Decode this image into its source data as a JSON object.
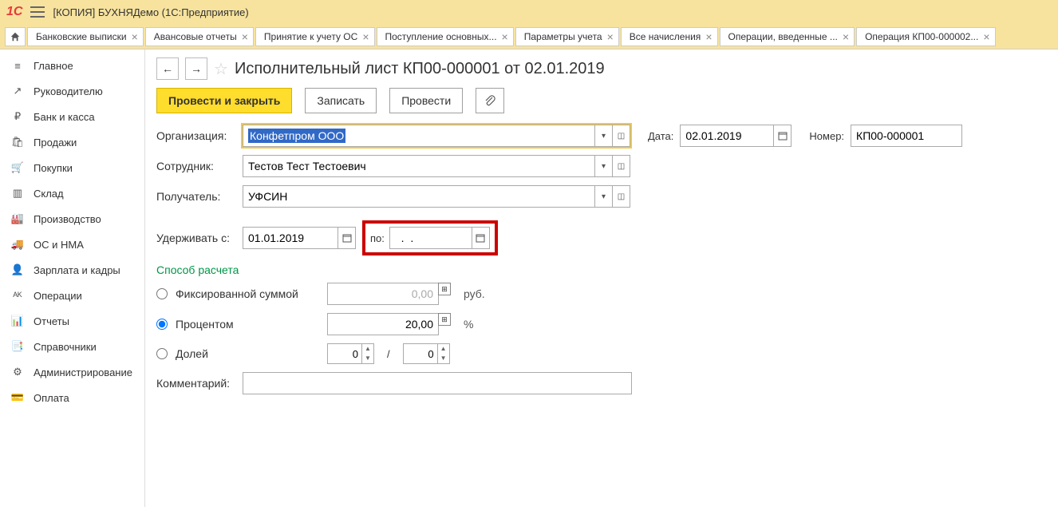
{
  "titlebar": {
    "text": "[КОПИЯ] БУХНЯДемо  (1С:Предприятие)"
  },
  "tabs": [
    {
      "label": "Банковские выписки"
    },
    {
      "label": "Авансовые отчеты"
    },
    {
      "label": "Принятие к учету ОС"
    },
    {
      "label": "Поступление основных..."
    },
    {
      "label": "Параметры учета"
    },
    {
      "label": "Все начисления"
    },
    {
      "label": "Операции, введенные ..."
    },
    {
      "label": "Операция КП00-000002..."
    }
  ],
  "sidebar": {
    "items": [
      {
        "label": "Главное",
        "icon": "≡"
      },
      {
        "label": "Руководителю",
        "icon": "↗"
      },
      {
        "label": "Банк и касса",
        "icon": "₽"
      },
      {
        "label": "Продажи",
        "icon": "🛍"
      },
      {
        "label": "Покупки",
        "icon": "🛒"
      },
      {
        "label": "Склад",
        "icon": "▥"
      },
      {
        "label": "Производство",
        "icon": "🏭"
      },
      {
        "label": "ОС и НМА",
        "icon": "🚚"
      },
      {
        "label": "Зарплата и кадры",
        "icon": "👤"
      },
      {
        "label": "Операции",
        "icon": "ᴬᴷ"
      },
      {
        "label": "Отчеты",
        "icon": "📊"
      },
      {
        "label": "Справочники",
        "icon": "📑"
      },
      {
        "label": "Администрирование",
        "icon": "⚙"
      },
      {
        "label": "Оплата",
        "icon": "💳"
      }
    ]
  },
  "page": {
    "title": "Исполнительный лист КП00-000001 от 02.01.2019",
    "toolbar": {
      "primary": "Провести и закрыть",
      "save": "Записать",
      "post": "Провести"
    },
    "labels": {
      "org": "Организация:",
      "emp": "Сотрудник:",
      "recv": "Получатель:",
      "withhold": "Удерживать с:",
      "po": "по:",
      "date": "Дата:",
      "number": "Номер:",
      "calc_method": "Способ расчета",
      "fixed": "Фиксированной суммой",
      "percent": "Процентом",
      "share": "Долей",
      "rub": "руб.",
      "pct": "%",
      "comment": "Комментарий:",
      "slash": "/"
    },
    "values": {
      "org": "Конфетпром ООО",
      "emp": "Тестов Тест Тестоевич",
      "recv": "УФСИН",
      "date_from": "01.01.2019",
      "date_to": "  .  .    ",
      "date": "02.01.2019",
      "number": "КП00-000001",
      "fixed_amount": "0,00",
      "percent_amount": "20,00",
      "share_n": "0",
      "share_d": "0",
      "comment": ""
    }
  }
}
